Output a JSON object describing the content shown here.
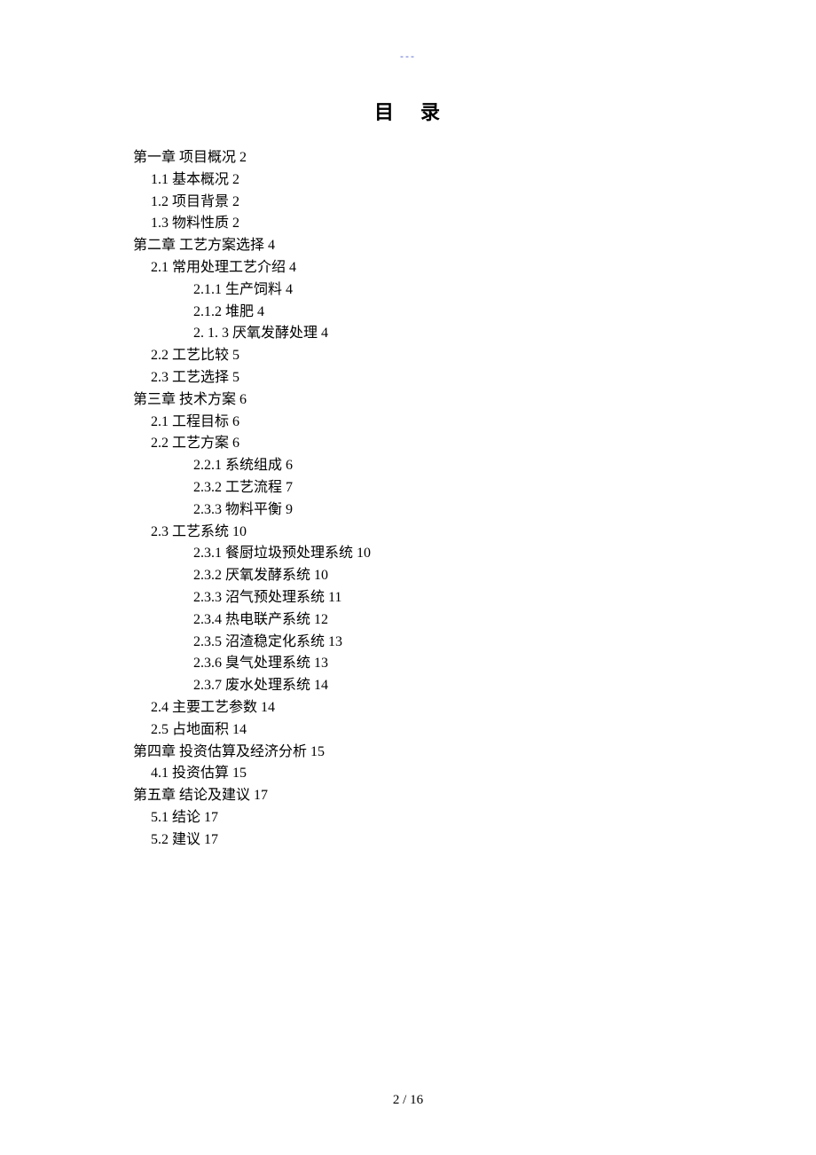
{
  "header_mark": "---",
  "title_left": "目",
  "title_right": "录",
  "toc": [
    {
      "lvl": 1,
      "t": "第一章  项目概况 2"
    },
    {
      "lvl": 2,
      "t": "1.1 基本概况 2"
    },
    {
      "lvl": 2,
      "t": "1.2 项目背景 2"
    },
    {
      "lvl": 2,
      "t": "1.3 物料性质 2"
    },
    {
      "lvl": 1,
      "t": "第二章  工艺方案选择 4"
    },
    {
      "lvl": 2,
      "t": "2.1 常用处理工艺介绍 4"
    },
    {
      "lvl": 3,
      "t": "2.1.1  生产饲料 4"
    },
    {
      "lvl": 3,
      "t": "2.1.2  堆肥 4"
    },
    {
      "lvl": 3,
      "t": "2. 1. 3  厌氧发酵处理 4"
    },
    {
      "lvl": 2,
      "t": "2.2 工艺比较 5"
    },
    {
      "lvl": 2,
      "t": "2.3 工艺选择 5"
    },
    {
      "lvl": 1,
      "t": "第三章  技术方案 6"
    },
    {
      "lvl": 2,
      "t": "2.1 工程目标 6"
    },
    {
      "lvl": 2,
      "t": "2.2 工艺方案 6"
    },
    {
      "lvl": 3,
      "t": "2.2.1  系统组成 6"
    },
    {
      "lvl": 3,
      "t": "2.3.2  工艺流程 7"
    },
    {
      "lvl": 3,
      "t": "2.3.3  物料平衡 9"
    },
    {
      "lvl": 2,
      "t": "2.3 工艺系统 10"
    },
    {
      "lvl": 3,
      "t": "2.3.1  餐厨垃圾预处理系统 10"
    },
    {
      "lvl": 3,
      "t": "2.3.2  厌氧发酵系统 10"
    },
    {
      "lvl": 3,
      "t": "2.3.3  沼气预处理系统 11"
    },
    {
      "lvl": 3,
      "t": "2.3.4  热电联产系统 12"
    },
    {
      "lvl": 3,
      "t": "2.3.5  沼渣稳定化系统 13"
    },
    {
      "lvl": 3,
      "t": "2.3.6  臭气处理系统 13"
    },
    {
      "lvl": 3,
      "t": "2.3.7  废水处理系统 14"
    },
    {
      "lvl": 2,
      "t": "2.4 主要工艺参数 14"
    },
    {
      "lvl": 2,
      "t": "2.5 占地面积 14"
    },
    {
      "lvl": 1,
      "t": "第四章  投资估算及经济分析 15"
    },
    {
      "lvl": 2,
      "t": "4.1  投资估算 15"
    },
    {
      "lvl": 1,
      "t": "第五章  结论及建议 17"
    },
    {
      "lvl": 2,
      "t": "5.1 结论 17"
    },
    {
      "lvl": 2,
      "t": "5.2 建议 17"
    }
  ],
  "footer": "2  / 16"
}
